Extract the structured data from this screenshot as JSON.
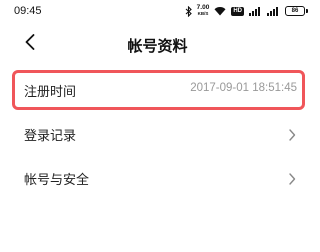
{
  "status_bar": {
    "time": "09:45",
    "net_speed": "7.00",
    "net_unit": "KB/S",
    "hd_label": "HD",
    "signal_label": "4G",
    "battery": "86",
    "icons": [
      "bluetooth-icon",
      "wifi-icon",
      "signal-icon",
      "battery-icon"
    ]
  },
  "header": {
    "title": "帐号资料",
    "back_icon": "chevron-left-icon"
  },
  "items": [
    {
      "label": "注册时间",
      "value": "2017-09-01 18:51:45"
    },
    {
      "label": "登录记录",
      "icon": "chevron-right-icon"
    },
    {
      "label": "帐号与安全",
      "icon": "chevron-right-icon"
    }
  ],
  "highlight_color": "#f0565a",
  "label_color": "#222222",
  "value_color": "#999999"
}
